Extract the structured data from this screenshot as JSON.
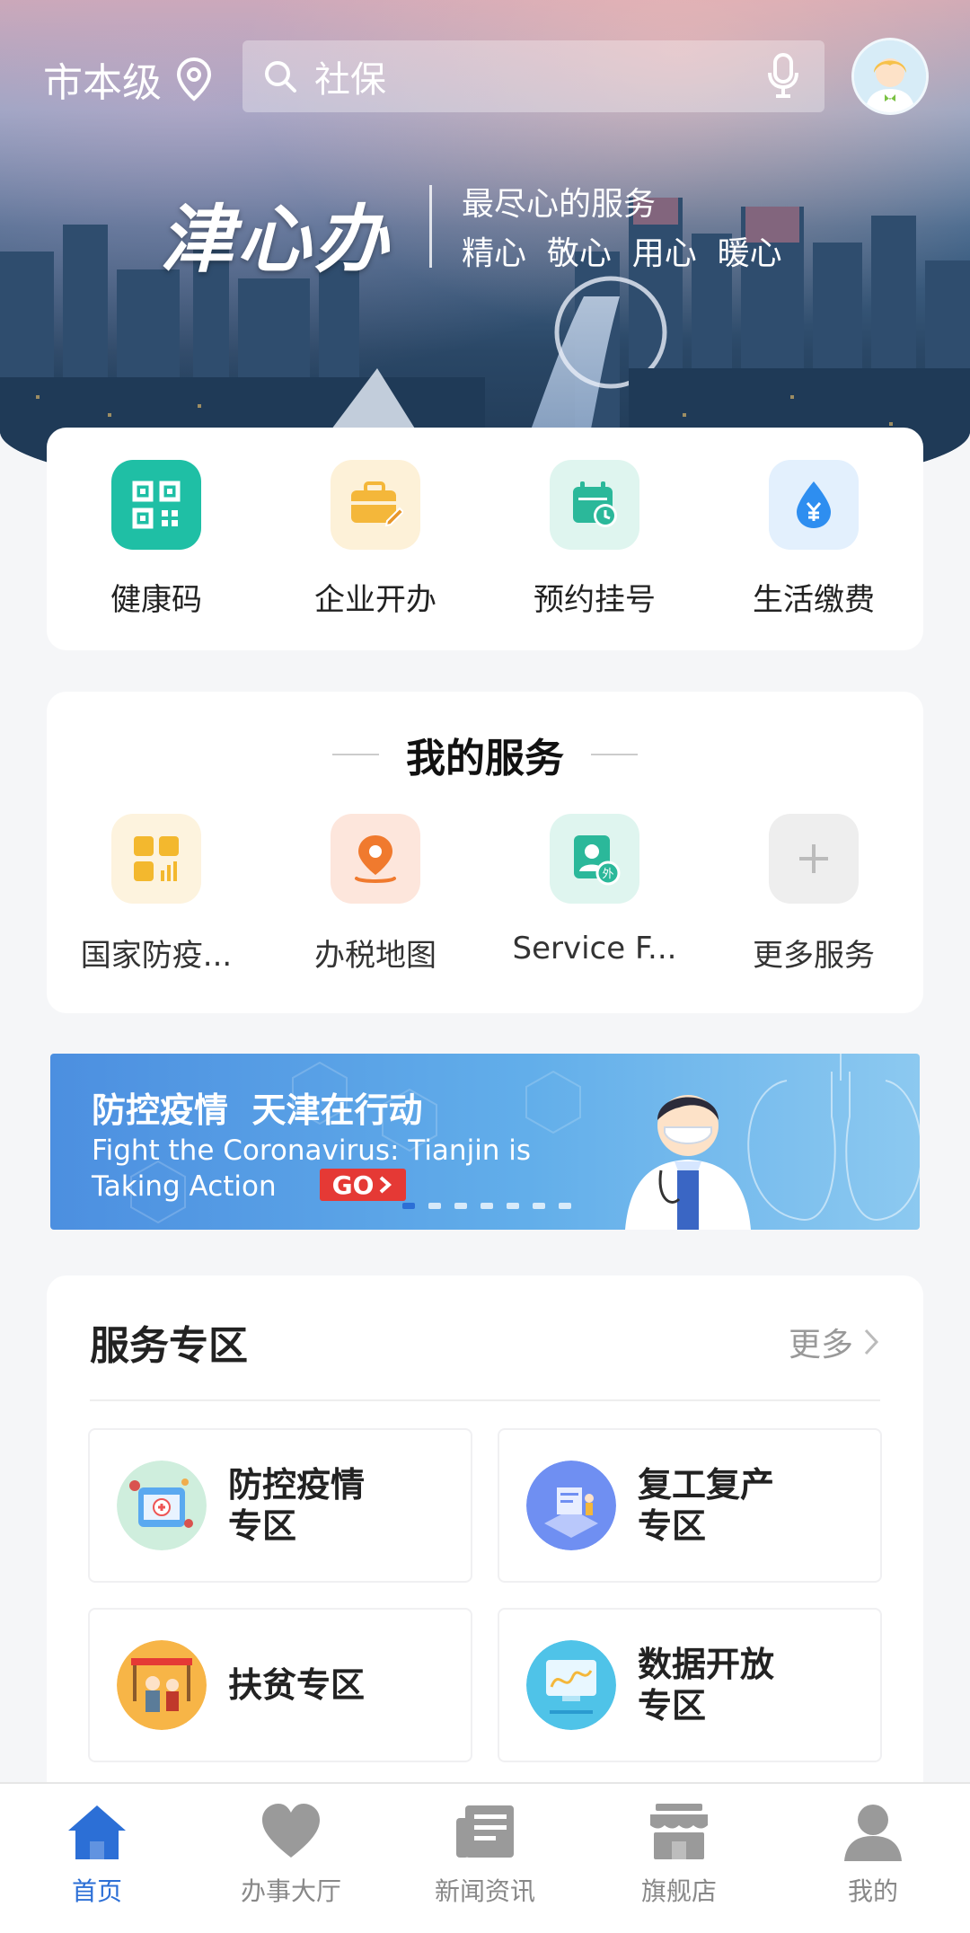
{
  "header": {
    "location": "市本级",
    "search_placeholder": "社保",
    "brand_logo_text": "津心办",
    "slogan_line1": "最尽心的服务",
    "slogan_line2": "精心  敬心  用心  暖心"
  },
  "quick_actions": [
    {
      "label": "健康码",
      "icon": "qr-code-icon",
      "color": "#1fbfa5"
    },
    {
      "label": "企业开办",
      "icon": "briefcase-icon",
      "color": "#f4b73a"
    },
    {
      "label": "预约挂号",
      "icon": "calendar-clock-icon",
      "color": "#2bb89a"
    },
    {
      "label": "生活缴费",
      "icon": "water-drop-yuan-icon",
      "color": "#2e8ef0"
    }
  ],
  "my_services": {
    "title": "我的服务",
    "items": [
      {
        "label": "国家防疫...",
        "icon": "dashboard-grid-icon",
        "color": "#f3b82e"
      },
      {
        "label": "办税地图",
        "icon": "map-pin-icon",
        "color": "#f07a2e"
      },
      {
        "label": "Service F...",
        "icon": "foreigner-card-icon",
        "color": "#2bb89a"
      },
      {
        "label": "更多服务",
        "icon": "plus-icon",
        "color": "#bbbbbb"
      }
    ]
  },
  "banner": {
    "title": "防控疫情  天津在行动",
    "subtitle": "Fight the Coronavirus: Tianjin is Taking Action",
    "go_label": "GO",
    "page_count": 7,
    "active_page": 1
  },
  "service_zone": {
    "title": "服务专区",
    "more_label": "更多",
    "tiles": [
      {
        "line1": "防控疫情",
        "line2": "专区"
      },
      {
        "line1": "复工复产",
        "line2": "专区"
      },
      {
        "line1": "扶贫专区",
        "line2": ""
      },
      {
        "line1": "数据开放",
        "line2": "专区"
      }
    ]
  },
  "tab_bar": {
    "tabs": [
      {
        "label": "首页",
        "icon": "home-icon",
        "active": true
      },
      {
        "label": "办事大厅",
        "icon": "heart-icon",
        "active": false
      },
      {
        "label": "新闻资讯",
        "icon": "newspaper-icon",
        "active": false
      },
      {
        "label": "旗舰店",
        "icon": "store-icon",
        "active": false
      },
      {
        "label": "我的",
        "icon": "person-icon",
        "active": false
      }
    ],
    "active_color": "#2c6fd6",
    "inactive_color": "#888888"
  }
}
